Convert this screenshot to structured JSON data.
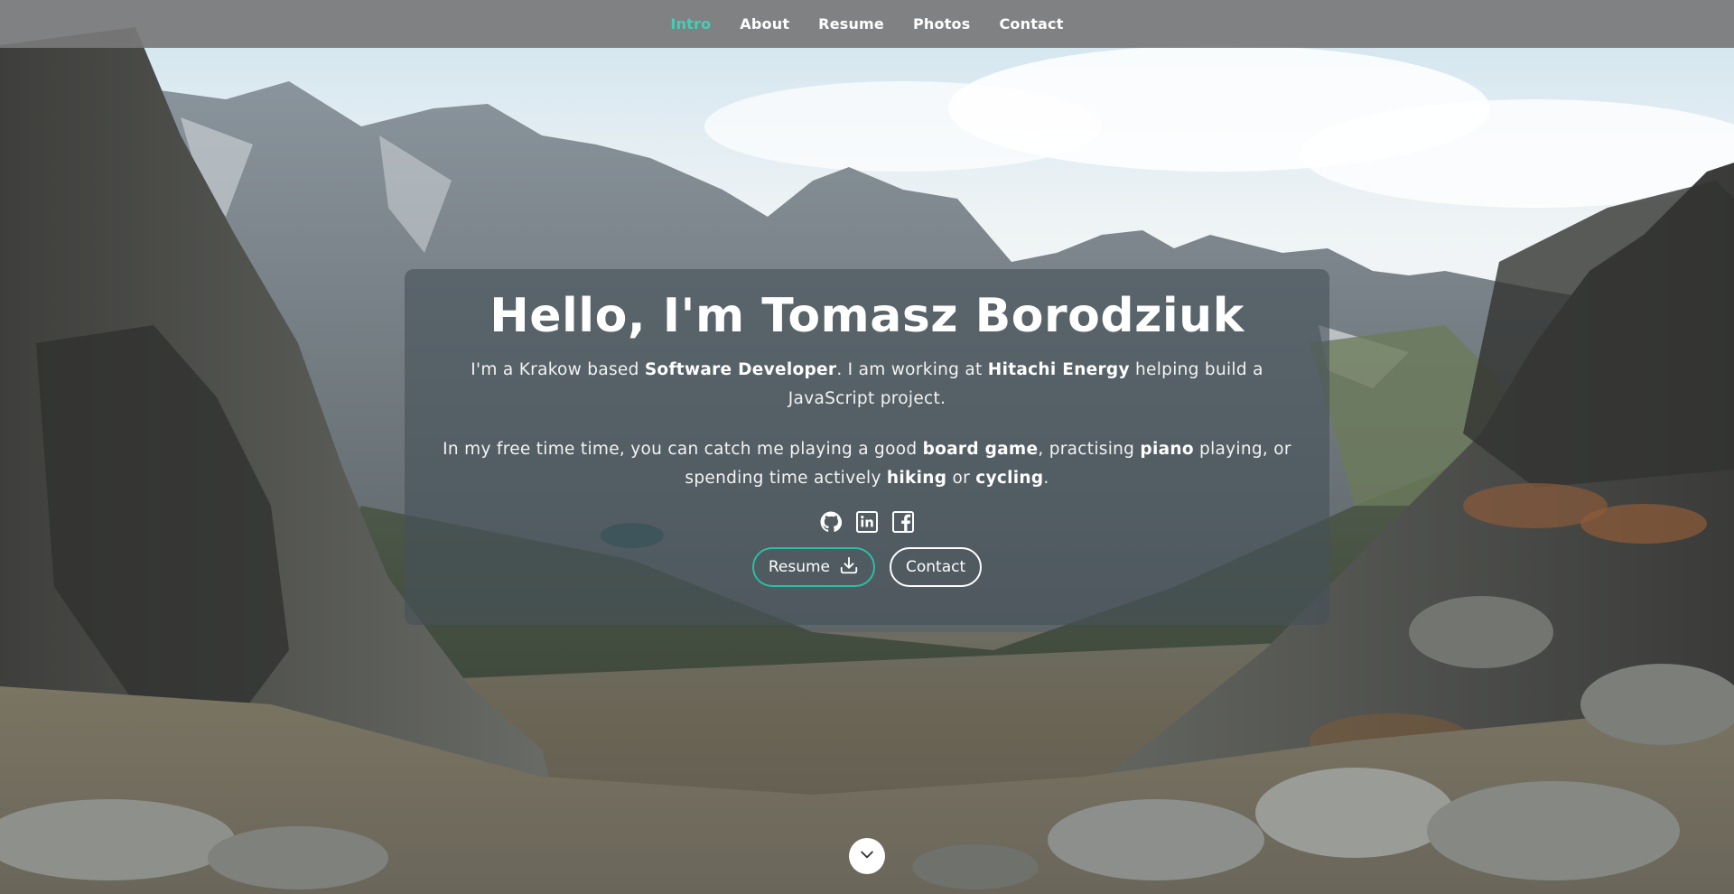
{
  "nav": {
    "items": [
      {
        "label": "Intro",
        "active": true
      },
      {
        "label": "About",
        "active": false
      },
      {
        "label": "Resume",
        "active": false
      },
      {
        "label": "Photos",
        "active": false
      },
      {
        "label": "Contact",
        "active": false
      }
    ]
  },
  "intro": {
    "title": "Hello, I'm Tomasz Borodziuk",
    "p1": {
      "t1": "I'm a Krakow based ",
      "b1": "Software Developer",
      "t2": ". I am working at ",
      "b2": "Hitachi Energy",
      "t3": " helping build a JavaScript project."
    },
    "p2": {
      "t1": "In my free time time, you can catch me playing a good ",
      "b1": "board game",
      "t2": ", practising ",
      "b2": "piano",
      "t3": " playing, or spending time actively ",
      "b3": "hiking",
      "t4": " or ",
      "b4": "cycling",
      "t5": "."
    },
    "social": [
      "github-icon",
      "linkedin-icon",
      "facebook-icon"
    ],
    "buttons": {
      "resume": "Resume",
      "contact": "Contact"
    }
  },
  "colors": {
    "accent": "#3fd0b8",
    "resume_border": "#2bbfa5",
    "navbar_bg": "#787878",
    "card_bg": "#46505a"
  },
  "icons": {
    "download": "download-icon",
    "scroll": "chevron-down-icon"
  }
}
